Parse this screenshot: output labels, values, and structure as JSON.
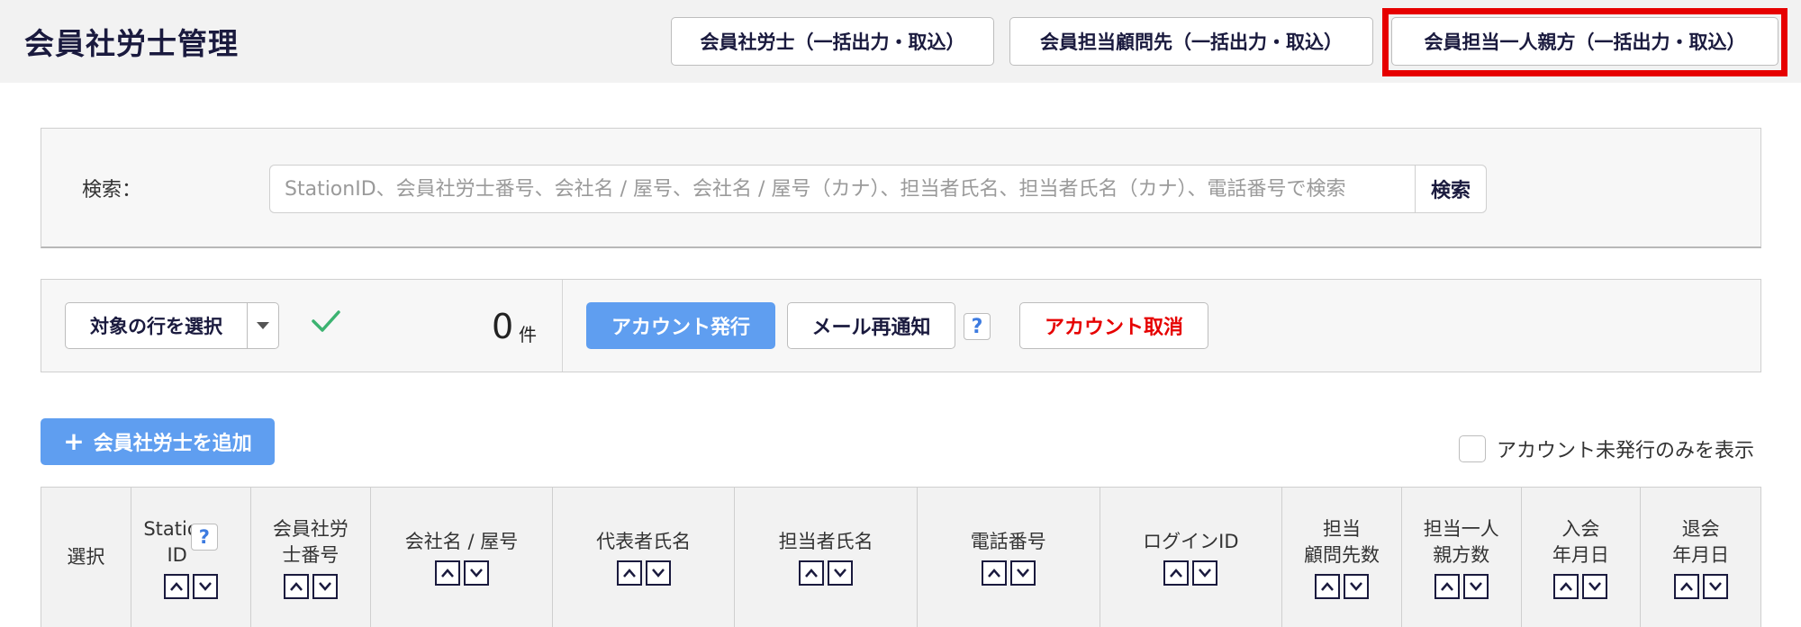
{
  "header": {
    "title": "会員社労士管理",
    "buttons": [
      "会員社労士（一括出力・取込）",
      "会員担当顧問先（一括出力・取込）",
      "会員担当一人親方（一括出力・取込）"
    ],
    "highlight_color": "#e60000"
  },
  "search": {
    "label": "検索：",
    "placeholder": "StationID、会員社労士番号、会社名 / 屋号、会社名 / 屋号（カナ）、担当者氏名、担当者氏名（カナ）、電話番号で検索",
    "button": "検索"
  },
  "actions": {
    "row_select": "対象の行を選択",
    "count": "0",
    "count_unit": "件",
    "issue_account": "アカウント発行",
    "resend_mail": "メール再通知",
    "help": "?",
    "cancel_account": "アカウント取消"
  },
  "add_button": "会員社労士を追加",
  "filter": {
    "label": "アカウント未発行のみを表示",
    "checked": false
  },
  "table": {
    "columns": [
      {
        "label": "選択",
        "sortable": false
      },
      {
        "label": "Station\nID",
        "sortable": true,
        "help": "?"
      },
      {
        "label": "会員社労\n士番号",
        "sortable": true
      },
      {
        "label": "会社名 / 屋号",
        "sortable": true
      },
      {
        "label": "代表者氏名",
        "sortable": true
      },
      {
        "label": "担当者氏名",
        "sortable": true
      },
      {
        "label": "電話番号",
        "sortable": true
      },
      {
        "label": "ログインID",
        "sortable": true
      },
      {
        "label": "担当\n顧問先数",
        "sortable": true
      },
      {
        "label": "担当一人\n親方数",
        "sortable": true
      },
      {
        "label": "入会\n年月日",
        "sortable": true
      },
      {
        "label": "退会\n年月日",
        "sortable": true
      }
    ]
  },
  "colors": {
    "primary": "#5f9ef0",
    "danger": "#e60000",
    "text_dark": "#1a1a3e",
    "check": "#3cb371"
  }
}
